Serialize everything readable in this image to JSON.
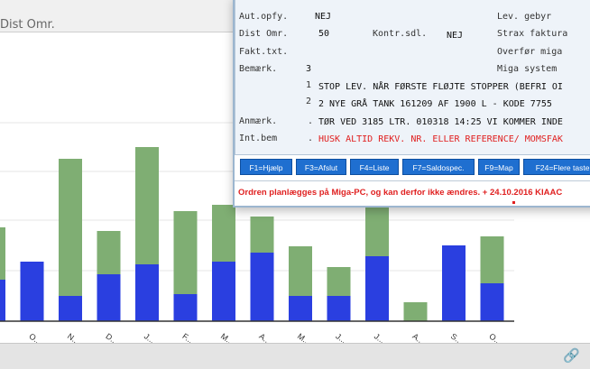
{
  "background": {
    "header_fragment": "Dist Omr.",
    "colors": {
      "green": "#7fae73",
      "blue": "#2a3fe0",
      "axis": "#333333"
    }
  },
  "chart_data": {
    "type": "bar",
    "stacked": true,
    "categories": [
      "",
      "O...",
      "N...",
      "D...",
      "J...",
      "F...",
      "M...",
      "A...",
      "M...",
      "J...",
      "J...",
      "A...",
      "S...",
      "O..."
    ],
    "series": [
      {
        "values": [
          46,
          66,
          28,
          52,
          63,
          30,
          66,
          76,
          28,
          28,
          72,
          0,
          84,
          42
        ]
      },
      {
        "values": [
          58,
          0,
          152,
          48,
          130,
          92,
          63,
          40,
          55,
          32,
          82,
          21,
          0,
          52
        ]
      }
    ],
    "grid": true,
    "legend": "none"
  },
  "dialog": {
    "fields": [
      {
        "label": "Aut.opfy.",
        "value": "NEJ"
      },
      {
        "label": "Dist Omr.",
        "value": "50"
      },
      {
        "label": "Kontr.sdl.",
        "value": "NEJ"
      },
      {
        "label": "Fakt.txt.",
        "value": ""
      },
      {
        "label": "Bemærk.",
        "value": "3"
      }
    ],
    "right_labels": [
      "Lev. gebyr",
      "Strax faktura",
      "Overfør miga",
      "Miga system"
    ],
    "remark_lines": [
      {
        "num": "1",
        "text": "STOP LEV. NÅR FØRSTE FLØJTE STOPPER (BEFRI OI"
      },
      {
        "num": "2",
        "text": "2 NYE GRÅ TANK 161209 AF 1900 L - KODE 7755"
      }
    ],
    "anm_label": "Anmærk.",
    "anm_dot": ".",
    "anm_text": "TØR VED 3185 LTR. 010318 14:25 VI KOMMER INDE",
    "int_label": "Int.bem",
    "int_dot": ".",
    "int_text": "HUSK ALTID REKV. NR. ELLER REFERENCE/ MOMSFAK",
    "buttons": [
      "F1=Hjælp",
      "F3=Afslut",
      "F4=Liste",
      "F7=Saldospec.",
      "F9=Map",
      "F24=Flere taster"
    ],
    "status": "Ordren planlægges på Miga-PC, og kan derfor ikke ændres. + 24.10.2016 KIAAC"
  },
  "icons": {
    "link": "link-icon"
  }
}
